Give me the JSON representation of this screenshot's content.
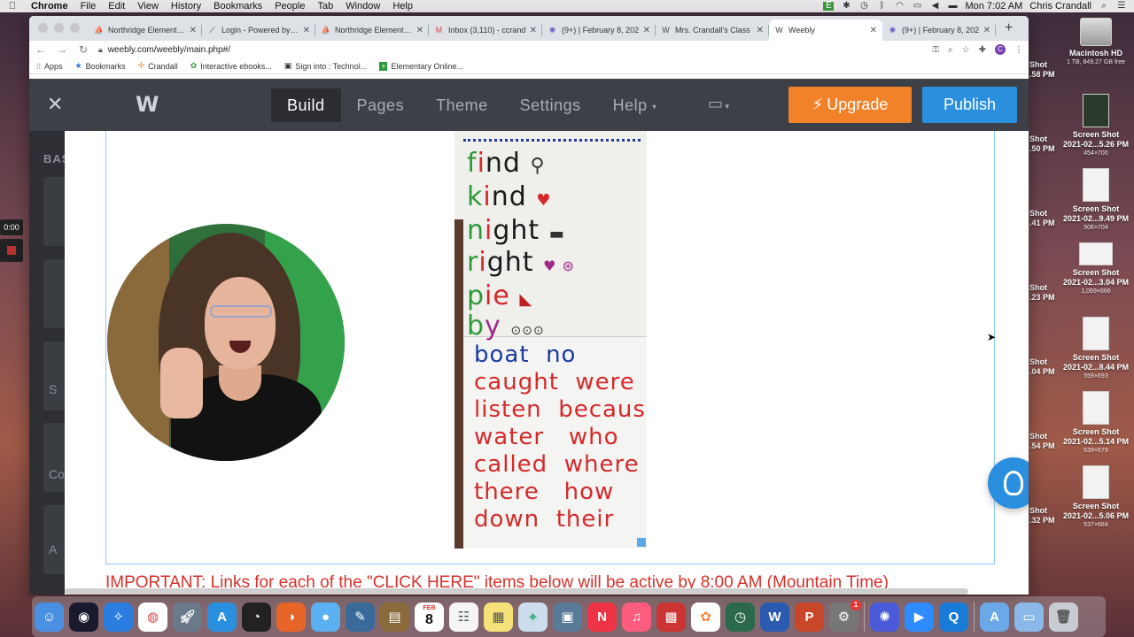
{
  "menubar": {
    "app": "Chrome",
    "items": [
      "File",
      "Edit",
      "View",
      "History",
      "Bookmarks",
      "People",
      "Tab",
      "Window",
      "Help"
    ],
    "clock": "Mon 7:02 AM",
    "user": "Chris Crandall"
  },
  "browser": {
    "tabs": [
      {
        "label": "Northridge Elementary",
        "icon": "school-icon",
        "active": false
      },
      {
        "label": "Login - Powered by Sk",
        "icon": "chart-icon",
        "active": false
      },
      {
        "label": "Northridge Elementary",
        "icon": "school-icon",
        "active": false
      },
      {
        "label": "Inbox (3,110) - ccrand",
        "icon": "gmail-icon",
        "active": false
      },
      {
        "label": "(9+) | February 8, 202",
        "icon": "flower-icon",
        "active": false
      },
      {
        "label": "Mrs. Crandall's Class",
        "icon": "weebly-icon",
        "active": false
      },
      {
        "label": "Weebly",
        "icon": "weebly-icon",
        "active": true
      },
      {
        "label": "(9+) | February 8, 202",
        "icon": "flower-icon",
        "active": false
      }
    ],
    "url": "weebly.com/weebly/main.php#/",
    "profile_initial": "C",
    "bookmarks": [
      {
        "label": "Apps",
        "icon": "apps-grid-icon"
      },
      {
        "label": "Bookmarks",
        "icon": "star-icon"
      },
      {
        "label": "Crandall",
        "icon": "pinwheel-icon"
      },
      {
        "label": "Interactive ebooks...",
        "icon": "ebook-icon"
      },
      {
        "label": "Sign into : Technol...",
        "icon": "tech-icon"
      },
      {
        "label": "Elementary Online...",
        "icon": "plus-icon"
      }
    ]
  },
  "weebly": {
    "close": "✕",
    "logo": "W",
    "nav": [
      "Build",
      "Pages",
      "Theme",
      "Settings",
      "Help"
    ],
    "active_nav": "Build",
    "upgrade": "Upgrade",
    "publish": "Publish",
    "left_panel_label": "BAS",
    "left_letters": [
      "S",
      "Co",
      "A"
    ]
  },
  "content": {
    "chart_words_top": [
      {
        "text": "find",
        "color": "#1a1a1a"
      },
      {
        "text": "kind",
        "color": "#1a1a1a"
      },
      {
        "text": "night",
        "color": "#1a1a1a"
      },
      {
        "text": "right",
        "color": "#1a1a1a"
      },
      {
        "text": "pie",
        "color": "#1a1a1a"
      },
      {
        "text": "by",
        "color": "#1a1a1a"
      }
    ],
    "chart_words_bottom": [
      [
        "boat",
        "no"
      ],
      [
        "caught",
        "were"
      ],
      [
        "listen",
        "because"
      ],
      [
        "water",
        "who"
      ],
      [
        "called",
        "where"
      ],
      [
        "there",
        "how"
      ],
      [
        "down",
        "their"
      ]
    ],
    "important_text": "IMPORTANT: Links for each of the \"CLICK HERE\" items below will be active by 8:00 AM (Mountain Time)"
  },
  "desktop": {
    "timer": "0:00",
    "items": [
      {
        "t1": "Macintosh HD",
        "t2": "1 TB, 849.27 GB free"
      },
      {
        "t1": "Screen Shot",
        "t2": "2021-02...5.26 PM",
        "t3": "454×700"
      },
      {
        "t1": "Screen Shot",
        "t2": "2021-02...9.49 PM",
        "t3": "506×704"
      },
      {
        "t1": "Screen Shot",
        "t2": "2021-02...3.04 PM",
        "t3": "1,069×666"
      },
      {
        "t1": "Screen Shot",
        "t2": "2021-02...8.44 PM",
        "t3": "559×693"
      },
      {
        "t1": "Screen Shot",
        "t2": "2021-02...5.14 PM",
        "t3": "539×679"
      },
      {
        "t1": "Screen Shot",
        "t2": "2021-02...5.06 PM",
        "t3": "537×684"
      }
    ],
    "edge_labels": [
      {
        "t1": "Shot",
        "t2": ".58 PM"
      },
      {
        "t1": "Shot",
        "t2": ".50 PM"
      },
      {
        "t1": "Shot",
        "t2": ".41 PM"
      },
      {
        "t1": "Shot",
        "t2": ".23 PM"
      },
      {
        "t1": "Shot",
        "t2": ".04 PM"
      },
      {
        "t1": "Shot",
        "t2": ".54 PM"
      },
      {
        "t1": "Shot",
        "t2": ".32 PM"
      }
    ]
  },
  "dock": {
    "calendar_month": "FEB",
    "calendar_day": "8",
    "system_prefs_badge": "1"
  },
  "colors": {
    "weebly_bar": "#3d4046",
    "upgrade": "#f1822a",
    "publish": "#2b8fe0",
    "important_red": "#d6302a",
    "chart_blue": "#1c3ba0",
    "chart_red": "#d42a2a",
    "chart_green": "#2f9a3a"
  }
}
